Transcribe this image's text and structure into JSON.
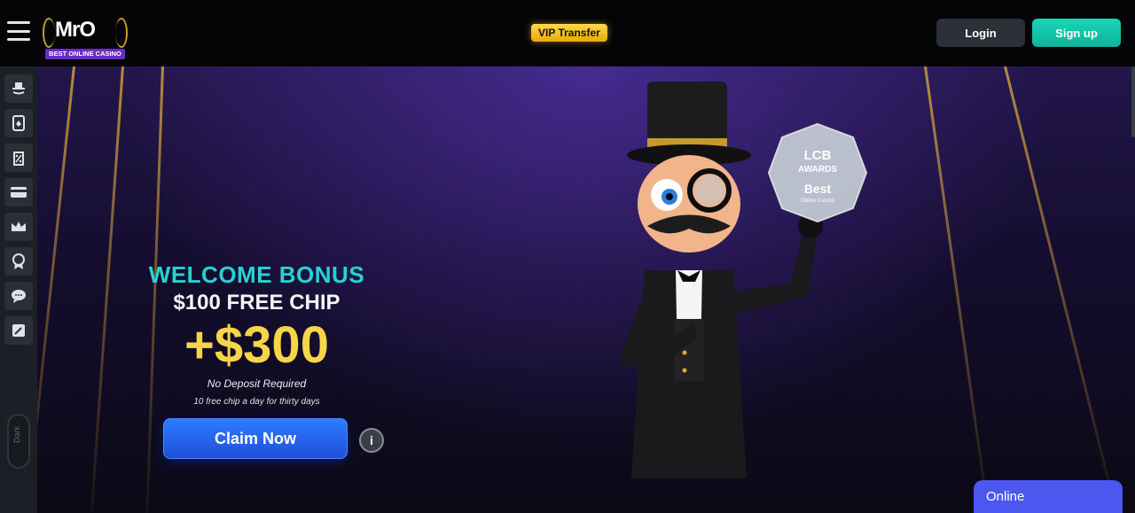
{
  "header": {
    "menu_icon": "hamburger-icon",
    "logo": {
      "word": "MrO",
      "tagline": "BEST ONLINE CASINO"
    },
    "vip_label": "VIP Transfer",
    "login_label": "Login",
    "signup_label": "Sign up"
  },
  "sidebar": {
    "items": [
      {
        "icon": "mascot-face-icon"
      },
      {
        "icon": "cards-icon"
      },
      {
        "icon": "percent-tag-icon"
      },
      {
        "icon": "credit-card-icon"
      },
      {
        "icon": "crown-icon"
      },
      {
        "icon": "award-badge-icon"
      },
      {
        "icon": "chat-support-icon"
      },
      {
        "icon": "edit-note-icon"
      }
    ],
    "dark_toggle_label": "Dark"
  },
  "hero": {
    "promo": {
      "title": "WELCOME BONUS",
      "subtitle": "$100 FREE CHIP",
      "amount": "+$300",
      "note": "No Deposit Required",
      "detail": "10 free chip a day for thirty days"
    },
    "claim_label": "Claim Now",
    "info_label": "i",
    "award": {
      "line1": "LCB",
      "line2": "AWARDS",
      "line3": "Best",
      "line4": "Online Casino"
    }
  },
  "chat": {
    "label": "Online"
  },
  "colors": {
    "accent": "#26d3d3",
    "gold": "#f7d54a",
    "claim": "#2f7cff",
    "signup": "#16d8b6",
    "chat": "#4c57f0"
  }
}
